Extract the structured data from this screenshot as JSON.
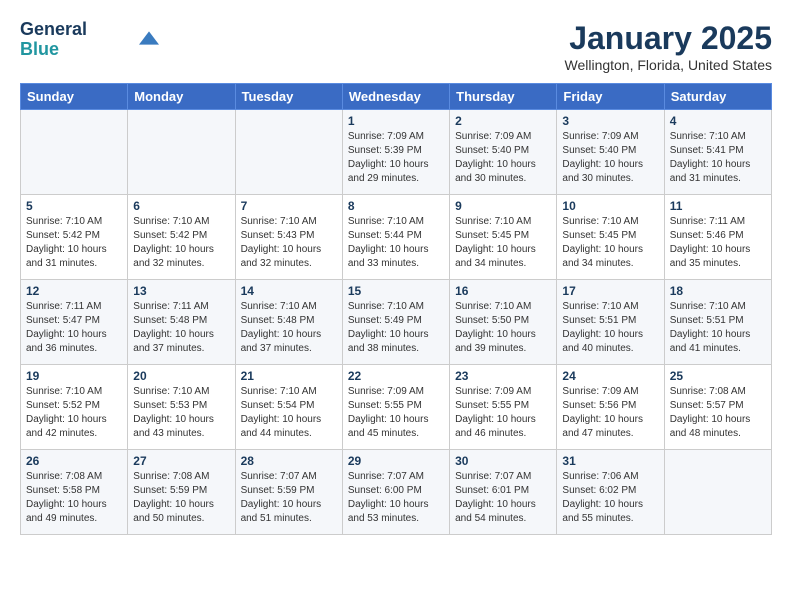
{
  "header": {
    "logo_line1": "General",
    "logo_line2": "Blue",
    "title": "January 2025",
    "subtitle": "Wellington, Florida, United States"
  },
  "days_of_week": [
    "Sunday",
    "Monday",
    "Tuesday",
    "Wednesday",
    "Thursday",
    "Friday",
    "Saturday"
  ],
  "weeks": [
    [
      {
        "day": "",
        "info": ""
      },
      {
        "day": "",
        "info": ""
      },
      {
        "day": "",
        "info": ""
      },
      {
        "day": "1",
        "info": "Sunrise: 7:09 AM\nSunset: 5:39 PM\nDaylight: 10 hours\nand 29 minutes."
      },
      {
        "day": "2",
        "info": "Sunrise: 7:09 AM\nSunset: 5:40 PM\nDaylight: 10 hours\nand 30 minutes."
      },
      {
        "day": "3",
        "info": "Sunrise: 7:09 AM\nSunset: 5:40 PM\nDaylight: 10 hours\nand 30 minutes."
      },
      {
        "day": "4",
        "info": "Sunrise: 7:10 AM\nSunset: 5:41 PM\nDaylight: 10 hours\nand 31 minutes."
      }
    ],
    [
      {
        "day": "5",
        "info": "Sunrise: 7:10 AM\nSunset: 5:42 PM\nDaylight: 10 hours\nand 31 minutes."
      },
      {
        "day": "6",
        "info": "Sunrise: 7:10 AM\nSunset: 5:42 PM\nDaylight: 10 hours\nand 32 minutes."
      },
      {
        "day": "7",
        "info": "Sunrise: 7:10 AM\nSunset: 5:43 PM\nDaylight: 10 hours\nand 32 minutes."
      },
      {
        "day": "8",
        "info": "Sunrise: 7:10 AM\nSunset: 5:44 PM\nDaylight: 10 hours\nand 33 minutes."
      },
      {
        "day": "9",
        "info": "Sunrise: 7:10 AM\nSunset: 5:45 PM\nDaylight: 10 hours\nand 34 minutes."
      },
      {
        "day": "10",
        "info": "Sunrise: 7:10 AM\nSunset: 5:45 PM\nDaylight: 10 hours\nand 34 minutes."
      },
      {
        "day": "11",
        "info": "Sunrise: 7:11 AM\nSunset: 5:46 PM\nDaylight: 10 hours\nand 35 minutes."
      }
    ],
    [
      {
        "day": "12",
        "info": "Sunrise: 7:11 AM\nSunset: 5:47 PM\nDaylight: 10 hours\nand 36 minutes."
      },
      {
        "day": "13",
        "info": "Sunrise: 7:11 AM\nSunset: 5:48 PM\nDaylight: 10 hours\nand 37 minutes."
      },
      {
        "day": "14",
        "info": "Sunrise: 7:10 AM\nSunset: 5:48 PM\nDaylight: 10 hours\nand 37 minutes."
      },
      {
        "day": "15",
        "info": "Sunrise: 7:10 AM\nSunset: 5:49 PM\nDaylight: 10 hours\nand 38 minutes."
      },
      {
        "day": "16",
        "info": "Sunrise: 7:10 AM\nSunset: 5:50 PM\nDaylight: 10 hours\nand 39 minutes."
      },
      {
        "day": "17",
        "info": "Sunrise: 7:10 AM\nSunset: 5:51 PM\nDaylight: 10 hours\nand 40 minutes."
      },
      {
        "day": "18",
        "info": "Sunrise: 7:10 AM\nSunset: 5:51 PM\nDaylight: 10 hours\nand 41 minutes."
      }
    ],
    [
      {
        "day": "19",
        "info": "Sunrise: 7:10 AM\nSunset: 5:52 PM\nDaylight: 10 hours\nand 42 minutes."
      },
      {
        "day": "20",
        "info": "Sunrise: 7:10 AM\nSunset: 5:53 PM\nDaylight: 10 hours\nand 43 minutes."
      },
      {
        "day": "21",
        "info": "Sunrise: 7:10 AM\nSunset: 5:54 PM\nDaylight: 10 hours\nand 44 minutes."
      },
      {
        "day": "22",
        "info": "Sunrise: 7:09 AM\nSunset: 5:55 PM\nDaylight: 10 hours\nand 45 minutes."
      },
      {
        "day": "23",
        "info": "Sunrise: 7:09 AM\nSunset: 5:55 PM\nDaylight: 10 hours\nand 46 minutes."
      },
      {
        "day": "24",
        "info": "Sunrise: 7:09 AM\nSunset: 5:56 PM\nDaylight: 10 hours\nand 47 minutes."
      },
      {
        "day": "25",
        "info": "Sunrise: 7:08 AM\nSunset: 5:57 PM\nDaylight: 10 hours\nand 48 minutes."
      }
    ],
    [
      {
        "day": "26",
        "info": "Sunrise: 7:08 AM\nSunset: 5:58 PM\nDaylight: 10 hours\nand 49 minutes."
      },
      {
        "day": "27",
        "info": "Sunrise: 7:08 AM\nSunset: 5:59 PM\nDaylight: 10 hours\nand 50 minutes."
      },
      {
        "day": "28",
        "info": "Sunrise: 7:07 AM\nSunset: 5:59 PM\nDaylight: 10 hours\nand 51 minutes."
      },
      {
        "day": "29",
        "info": "Sunrise: 7:07 AM\nSunset: 6:00 PM\nDaylight: 10 hours\nand 53 minutes."
      },
      {
        "day": "30",
        "info": "Sunrise: 7:07 AM\nSunset: 6:01 PM\nDaylight: 10 hours\nand 54 minutes."
      },
      {
        "day": "31",
        "info": "Sunrise: 7:06 AM\nSunset: 6:02 PM\nDaylight: 10 hours\nand 55 minutes."
      },
      {
        "day": "",
        "info": ""
      }
    ]
  ]
}
